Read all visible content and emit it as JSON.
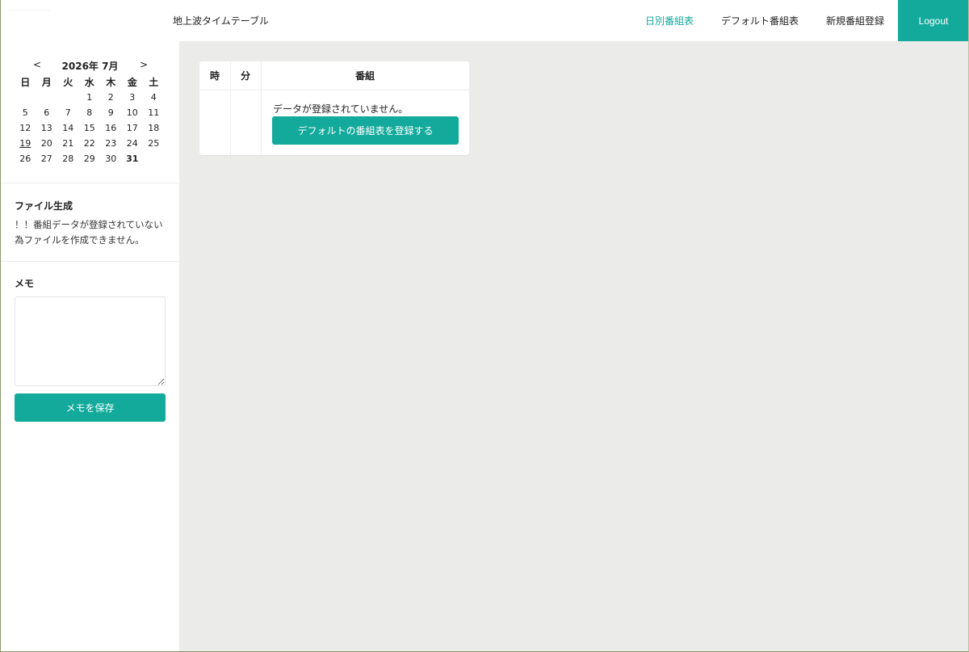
{
  "header": {
    "app_title": "地上波タイムテーブル",
    "nav": [
      {
        "label": "日別番組表",
        "active": true
      },
      {
        "label": "デフォルト番組表",
        "active": false
      },
      {
        "label": "新規番組登録",
        "active": false
      }
    ],
    "logout_label": "Logout",
    "accent_color": "#13aa9c"
  },
  "calendar": {
    "prev": "<",
    "next": ">",
    "title": "2026年 7月",
    "weekdays": [
      "日",
      "月",
      "火",
      "水",
      "木",
      "金",
      "土"
    ],
    "weeks": [
      [
        "",
        "",
        "",
        "1",
        "2",
        "3",
        "4"
      ],
      [
        "5",
        "6",
        "7",
        "8",
        "9",
        "10",
        "11"
      ],
      [
        "12",
        "13",
        "14",
        "15",
        "16",
        "17",
        "18"
      ],
      [
        "19",
        "20",
        "21",
        "22",
        "23",
        "24",
        "25"
      ],
      [
        "26",
        "27",
        "28",
        "29",
        "30",
        "31",
        ""
      ]
    ],
    "underlined_day": "19",
    "bold_day": "31"
  },
  "file_section": {
    "title": "ファイル生成",
    "message": "！！番組データが登録されていない為ファイルを作成できません。"
  },
  "memo_section": {
    "title": "メモ",
    "value": "",
    "save_label": "メモを保存"
  },
  "table": {
    "headers": [
      "時",
      "分",
      "番組"
    ],
    "empty_message": "データが登録されていません。",
    "register_button_label": "デフォルトの番組表を登録する"
  }
}
